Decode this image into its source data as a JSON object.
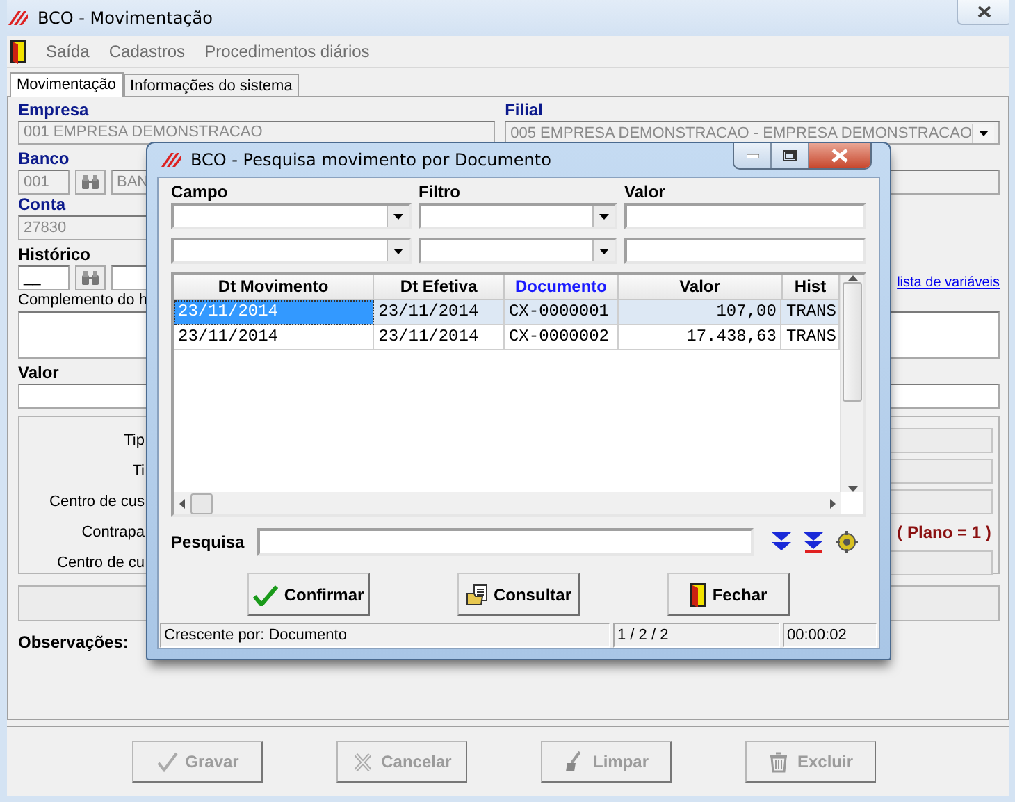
{
  "window": {
    "title": "BCO - Movimentação"
  },
  "menu": [
    {
      "label": "Saída",
      "kind": "exit"
    },
    {
      "label": "Cadastros",
      "kind": "plain"
    },
    {
      "label": "Procedimentos diários",
      "kind": "plain"
    }
  ],
  "tabs": [
    {
      "label": "Movimentação",
      "selected": true
    },
    {
      "label": "Informações do sistema",
      "selected": false
    }
  ],
  "form": {
    "empresa": {
      "label": "Empresa",
      "value": "001 EMPRESA DEMONSTRACAO"
    },
    "filial": {
      "label": "Filial",
      "value": "005 EMPRESA DEMONSTRACAO - EMPRESA DEMONSTRACAO"
    },
    "banco": {
      "label": "Banco",
      "code": "001",
      "name": "BAN"
    },
    "conta": {
      "label": "Conta",
      "value": "27830"
    },
    "historico": {
      "label": "Histórico",
      "code": "__"
    },
    "variables_link": "lista de variáveis",
    "complemento_label": "Complemento do h",
    "valor_label": "Valor",
    "group_rows": [
      {
        "label": "Tip"
      },
      {
        "label": "Ti"
      },
      {
        "label": "Centro de cus"
      },
      {
        "label": "Contrapa",
        "note": "( Plano = 1 )"
      },
      {
        "label": "Centro de cu"
      }
    ],
    "observacoes_label": "Observações:"
  },
  "actions": [
    {
      "label": "Gravar",
      "kind": "save",
      "disabled": true
    },
    {
      "label": "Cancelar",
      "kind": "cancel",
      "disabled": true
    },
    {
      "label": "Limpar",
      "kind": "clear",
      "disabled": true
    },
    {
      "label": "Excluir",
      "kind": "delete",
      "disabled": true
    }
  ],
  "dialog": {
    "title": "BCO - Pesquisa movimento por Documento",
    "filter_labels": [
      "Campo",
      "Filtro",
      "Valor"
    ],
    "columns": [
      {
        "label": "Dt Movimento",
        "sorted": false,
        "kind": "text"
      },
      {
        "label": "Dt Efetiva",
        "sorted": false,
        "kind": "text"
      },
      {
        "label": "Documento",
        "sorted": true,
        "kind": "text"
      },
      {
        "label": "Valor",
        "sorted": false,
        "kind": "number"
      },
      {
        "label": "Hist",
        "sorted": false,
        "kind": "text"
      }
    ],
    "rows": [
      {
        "selected": true,
        "cells": [
          "23/11/2014",
          "23/11/2014",
          "CX-0000001",
          "107,00",
          "TRANS"
        ]
      },
      {
        "selected": false,
        "cells": [
          "23/11/2014",
          "23/11/2014",
          "CX-0000002",
          "17.438,63",
          "TRANS"
        ]
      }
    ],
    "search_label": "Pesquisa",
    "buttons": [
      {
        "label": "Confirmar",
        "kind": "confirm"
      },
      {
        "label": "Consultar",
        "kind": "query"
      },
      {
        "label": "Fechar",
        "kind": "close"
      }
    ],
    "status_bar": [
      "Crescente por: Documento",
      "1 / 2 / 2",
      "00:00:02"
    ]
  }
}
